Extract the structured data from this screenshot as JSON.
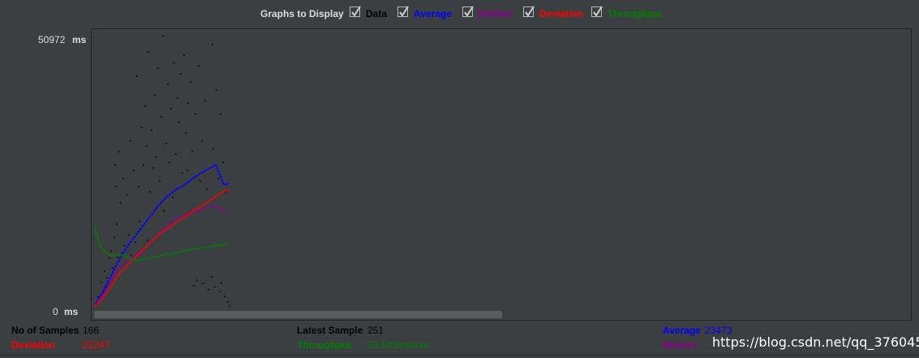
{
  "graphs_to_display": {
    "label": "Graphs to Display",
    "options": [
      {
        "label": "Data",
        "checked": true,
        "color": "#000000"
      },
      {
        "label": "Average",
        "checked": true,
        "color": "#0000ff"
      },
      {
        "label": "Median",
        "checked": true,
        "color": "#8b008b"
      },
      {
        "label": "Deviation",
        "checked": true,
        "color": "#ff0000"
      },
      {
        "label": "Throughput",
        "checked": true,
        "color": "#008000"
      }
    ]
  },
  "y_axis": {
    "max": "50972",
    "min": "0",
    "unit": "ms"
  },
  "chart_data": {
    "type": "scatter",
    "x_unit": "sample number",
    "y_unit": "ms",
    "ylim": [
      0,
      50972
    ],
    "series": [
      {
        "name": "Data",
        "color": "#000000",
        "kind": "scatter",
        "points": [
          [
            2,
            1200
          ],
          [
            4,
            2400
          ],
          [
            6,
            1800
          ],
          [
            8,
            5100
          ],
          [
            10,
            3300
          ],
          [
            12,
            7200
          ],
          [
            14,
            4300
          ],
          [
            15,
            6000
          ],
          [
            18,
            9700
          ],
          [
            20,
            11000
          ],
          [
            22,
            7800
          ],
          [
            24,
            13500
          ],
          [
            25,
            27000
          ],
          [
            26,
            23000
          ],
          [
            27,
            16000
          ],
          [
            28,
            9800
          ],
          [
            30,
            29500
          ],
          [
            32,
            20000
          ],
          [
            33,
            10500
          ],
          [
            35,
            24500
          ],
          [
            36,
            12000
          ],
          [
            38,
            8900
          ],
          [
            40,
            21500
          ],
          [
            42,
            14000
          ],
          [
            44,
            31500
          ],
          [
            45,
            10200
          ],
          [
            48,
            26000
          ],
          [
            50,
            12600
          ],
          [
            52,
            43500
          ],
          [
            54,
            23000
          ],
          [
            55,
            16500
          ],
          [
            58,
            34000
          ],
          [
            60,
            27000
          ],
          [
            62,
            38000
          ],
          [
            64,
            30500
          ],
          [
            65,
            13000
          ],
          [
            66,
            48000
          ],
          [
            68,
            22000
          ],
          [
            70,
            33500
          ],
          [
            72,
            26500
          ],
          [
            74,
            40000
          ],
          [
            76,
            28500
          ],
          [
            78,
            45000
          ],
          [
            80,
            24000
          ],
          [
            82,
            36000
          ],
          [
            84,
            51000
          ],
          [
            85,
            18500
          ],
          [
            88,
            31000
          ],
          [
            90,
            42000
          ],
          [
            92,
            27500
          ],
          [
            94,
            37500
          ],
          [
            96,
            21000
          ],
          [
            98,
            46000
          ],
          [
            100,
            29000
          ],
          [
            102,
            39500
          ],
          [
            104,
            35000
          ],
          [
            106,
            44000
          ],
          [
            108,
            25500
          ],
          [
            110,
            47500
          ],
          [
            112,
            33000
          ],
          [
            114,
            26000
          ],
          [
            115,
            38500
          ],
          [
            118,
            42500
          ],
          [
            120,
            29500
          ],
          [
            122,
            4500
          ],
          [
            124,
            36500
          ],
          [
            126,
            5500
          ],
          [
            128,
            45500
          ],
          [
            130,
            24000
          ],
          [
            132,
            31500
          ],
          [
            134,
            5000
          ],
          [
            136,
            39000
          ],
          [
            138,
            22500
          ],
          [
            140,
            3800
          ],
          [
            142,
            26500
          ],
          [
            144,
            6200
          ],
          [
            145,
            49500
          ],
          [
            146,
            30000
          ],
          [
            148,
            4300
          ],
          [
            150,
            41000
          ],
          [
            152,
            24500
          ],
          [
            154,
            3400
          ],
          [
            155,
            36500
          ],
          [
            156,
            5000
          ],
          [
            158,
            27500
          ],
          [
            160,
            2500
          ],
          [
            162,
            22000
          ],
          [
            164,
            1500
          ],
          [
            166,
            800
          ]
        ]
      },
      {
        "name": "Average",
        "color": "#0000ff",
        "kind": "line",
        "points": [
          [
            1,
            800
          ],
          [
            10,
            3000
          ],
          [
            20,
            6000
          ],
          [
            30,
            9000
          ],
          [
            40,
            11500
          ],
          [
            50,
            13500
          ],
          [
            60,
            15500
          ],
          [
            70,
            17500
          ],
          [
            80,
            19500
          ],
          [
            90,
            21000
          ],
          [
            100,
            22200
          ],
          [
            110,
            23000
          ],
          [
            120,
            24200
          ],
          [
            130,
            25200
          ],
          [
            140,
            26100
          ],
          [
            150,
            26900
          ],
          [
            160,
            23200
          ],
          [
            166,
            23473
          ]
        ]
      },
      {
        "name": "Median",
        "color": "#8b008b",
        "kind": "line",
        "points": [
          [
            1,
            700
          ],
          [
            10,
            2500
          ],
          [
            20,
            5000
          ],
          [
            30,
            7500
          ],
          [
            40,
            9000
          ],
          [
            50,
            10000
          ],
          [
            60,
            11000
          ],
          [
            70,
            12500
          ],
          [
            80,
            14000
          ],
          [
            90,
            15500
          ],
          [
            100,
            17000
          ],
          [
            110,
            17500
          ],
          [
            120,
            18000
          ],
          [
            130,
            18500
          ],
          [
            140,
            19000
          ],
          [
            150,
            19200
          ],
          [
            160,
            18500
          ],
          [
            166,
            18000
          ]
        ]
      },
      {
        "name": "Deviation",
        "color": "#ff0000",
        "kind": "line",
        "points": [
          [
            1,
            600
          ],
          [
            10,
            2000
          ],
          [
            20,
            4000
          ],
          [
            30,
            6500
          ],
          [
            40,
            8000
          ],
          [
            50,
            9500
          ],
          [
            60,
            11000
          ],
          [
            70,
            12500
          ],
          [
            80,
            14000
          ],
          [
            90,
            15000
          ],
          [
            100,
            16000
          ],
          [
            110,
            17000
          ],
          [
            120,
            18000
          ],
          [
            130,
            19000
          ],
          [
            140,
            20000
          ],
          [
            150,
            21000
          ],
          [
            160,
            22000
          ],
          [
            166,
            22247
          ]
        ]
      },
      {
        "name": "Throughput",
        "color": "#008000",
        "kind": "line",
        "points": [
          [
            1,
            15000
          ],
          [
            8,
            11500
          ],
          [
            15,
            10500
          ],
          [
            25,
            10000
          ],
          [
            35,
            10200
          ],
          [
            45,
            9300
          ],
          [
            55,
            9100
          ],
          [
            70,
            9600
          ],
          [
            85,
            10100
          ],
          [
            100,
            10500
          ],
          [
            115,
            11000
          ],
          [
            130,
            11400
          ],
          [
            145,
            11700
          ],
          [
            160,
            12000
          ],
          [
            166,
            12100
          ]
        ]
      }
    ]
  },
  "stats": {
    "samples_label": "No of Samples",
    "samples_value": "166",
    "deviation_label": "Deviation",
    "deviation_value": "22247",
    "latest_label": "Latest Sample",
    "latest_value": "251",
    "throughput_label": "Throughput",
    "throughput_value": "53.643/minute",
    "average_label": "Average",
    "average_value": "23473",
    "median_label": "Median"
  },
  "watermark": "https://blog.csdn.net/qq_37604508",
  "colors": {
    "background": "#3c3f41",
    "text": "#dcdcdc"
  }
}
